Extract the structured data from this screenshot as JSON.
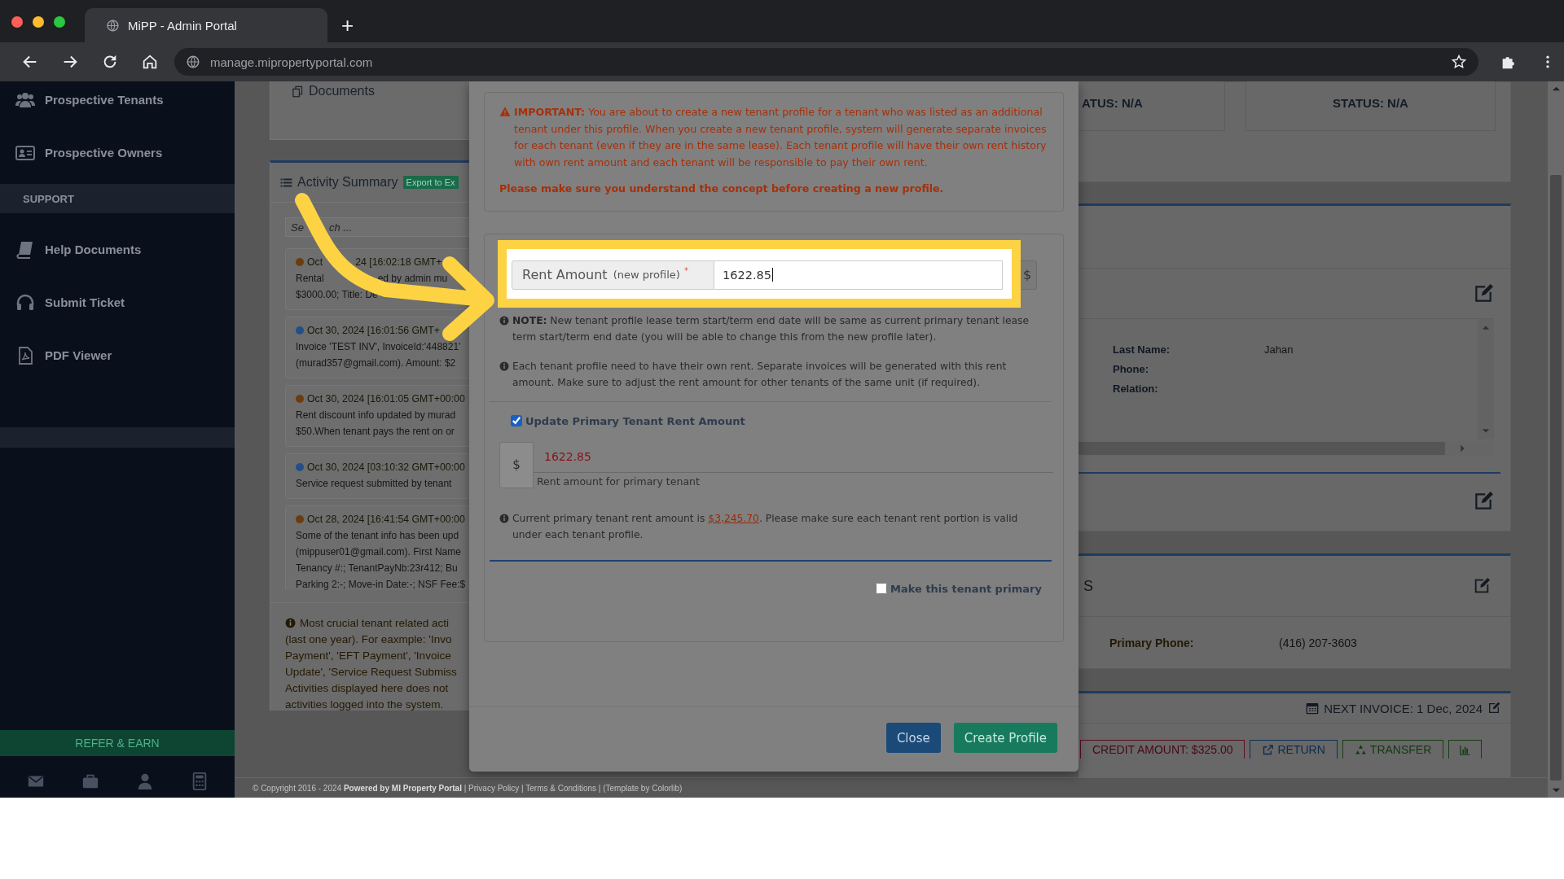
{
  "browser": {
    "tab_title": "MiPP - Admin Portal",
    "new_tab": "+",
    "url": "manage.mipropertyportal.com"
  },
  "sidebar": {
    "top_items": [
      {
        "label": "Prospective Tenants"
      },
      {
        "label": "Prospective Owners"
      }
    ],
    "section_title": "SUPPORT",
    "support_items": [
      {
        "label": "Help Documents"
      },
      {
        "label": "Submit Ticket"
      },
      {
        "label": "PDF Viewer"
      }
    ],
    "refer_button": "REFER & EARN"
  },
  "activity": {
    "documents_title": "Documents",
    "title": "Activity Summary",
    "export_button": "Export to Ex",
    "search_placeholder": [
      "Se",
      "ch ..."
    ],
    "entries": [
      {
        "color": "#6b3c10",
        "time": [
          "Oct",
          "24 [16:02:18 GMT+"
        ],
        "lines": [
          [
            "Rental",
            "ed by admin mu"
          ],
          "$3000.00; Title: De"
        ]
      },
      {
        "color": "#234f86",
        "time": "Oct 30, 2024 [16:01:56 GMT+",
        "lines": [
          "Invoice 'TEST INV', InvoiceId:'448821'",
          "(murad357@gmail.com). Amount: $2"
        ]
      },
      {
        "color": "#6b3c10",
        "time": "Oct 30, 2024 [16:01:05 GMT+00:00",
        "lines": [
          "Rent discount info updated by murad",
          "$50.When tenant pays the rent on or"
        ]
      },
      {
        "color": "#234f86",
        "time": "Oct 30, 2024 [03:10:32 GMT+00:00",
        "lines": [
          "Service request submitted by tenant"
        ]
      },
      {
        "color": "#6b3c10",
        "time": "Oct 28, 2024 [16:41:54 GMT+00:00",
        "lines": [
          "Some of the tenant info has been upd",
          "(mippuser01@gmail.com). First Name",
          "Tenancy #:; TenantPayNb:23r412; Bu",
          "Parking 2:-; Move-in Date:-; NSF Fee:$"
        ]
      }
    ],
    "note_lines": [
      "Most crucial tenant related acti",
      "(last one year). For eaxmple: 'Invo",
      "Payment', 'EFT Payment', 'Invoice",
      "Update', 'Service Request Submiss",
      "Activities displayed here does not",
      "activities logged into the system."
    ]
  },
  "background": {
    "status_cards": [
      "ATUS: N/A",
      "STATUS: N/A"
    ],
    "details": [
      {
        "label": "Last Name:",
        "value": "Jahan"
      },
      {
        "label": "Phone:"
      },
      {
        "label": "Relation:"
      }
    ],
    "contact_heading": "S",
    "contact": [
      {
        "label": "Primary Phone:",
        "value": "(416) 207-3603"
      }
    ],
    "next_invoice": "NEXT INVOICE: 1 Dec, 2024",
    "actions": [
      {
        "kind": "credit",
        "label": "CREDIT AMOUNT: $325.00"
      },
      {
        "kind": "return",
        "label": "RETURN"
      },
      {
        "kind": "transfer",
        "label": "TRANSFER"
      },
      {
        "kind": "chart"
      }
    ]
  },
  "modal": {
    "warning": "**IMPORTANT:** You are about to create a new tenant profile for a tenant who was listed as an additional tenant under this profile. When you create a new tenant profile, system will generate separate invoices for each tenant (even if they are in the same lease). Each tenant profile will have their own rent history with own rent amount and each tenant will be responsible to pay their own rent.",
    "warning_emphasis": "Please make sure you understand the concept before creating a new profile.",
    "rent_field": {
      "label": "Rent Amount",
      "sublabel": "(new profile)",
      "required_mark": "*",
      "value": "1622.85",
      "suffix": "$"
    },
    "notes": [
      "**NOTE:** New tenant profile lease term start/term end date will be same as current primary tenant lease term start/term end date (you will be able to change this from the new profile later).",
      "Each tenant profile need to have their own rent. Separate invoices will be generated with this rent amount. Make sure to adjust the rent amount for other tenants of the same unit (if required)."
    ],
    "update_primary": {
      "label": "Update Primary Tenant Rent Amount",
      "checked": true
    },
    "primary_rent": {
      "prefix": "$",
      "value": "1622.85",
      "help": "Rent amount for primary tenant"
    },
    "current_rent": {
      "before": "Current primary tenant rent amount is ",
      "link": "$3,245.70",
      "after": ". Please make sure each tenant rent portion is valid under each tenant profile."
    },
    "make_primary": {
      "label": "Make this tenant primary",
      "checked": false
    },
    "buttons": [
      {
        "kind": "secondary",
        "label": "Close"
      },
      {
        "kind": "primary",
        "label": "Create Profile"
      }
    ]
  },
  "footer": "© Copyright 2016 - 2024 **Powered by MI Property Portal** | Privacy Policy | Terms & Conditions | (Template by Colorlib)"
}
